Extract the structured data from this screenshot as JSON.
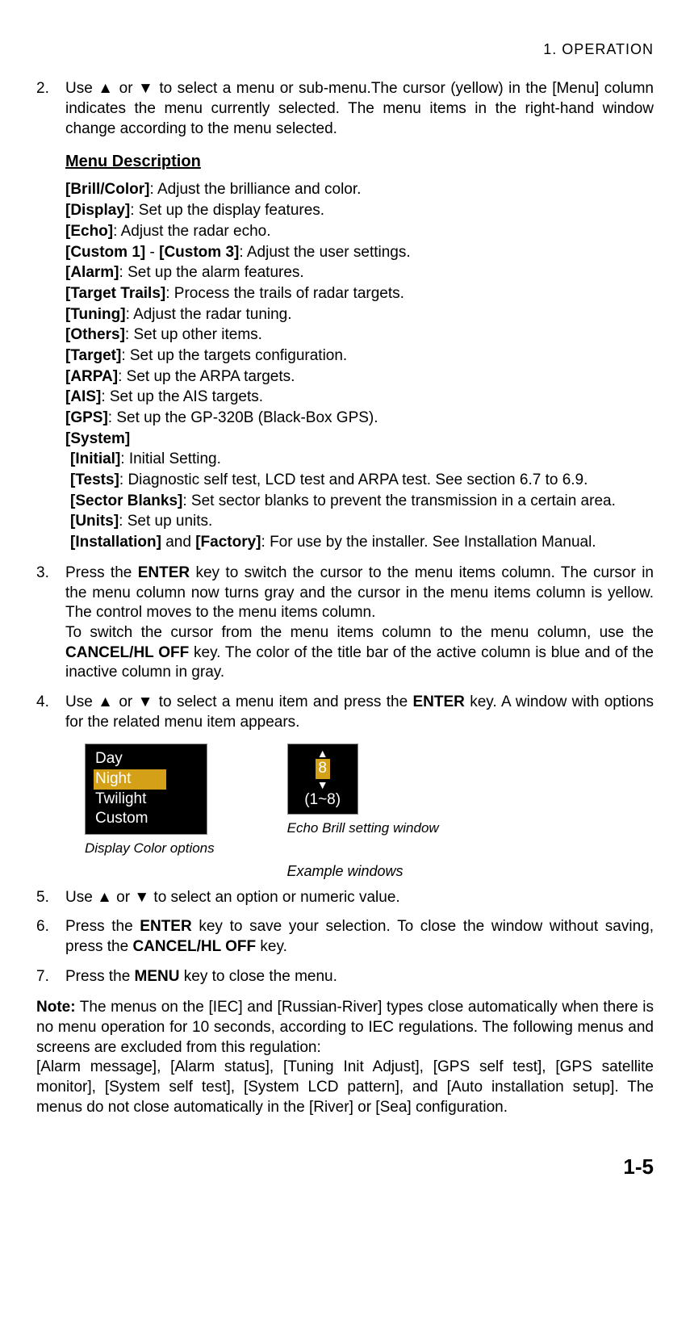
{
  "header": {
    "section": "1.  OPERATION"
  },
  "step2": {
    "num": "2.",
    "text_a": "Use ",
    "arr_up": "▲",
    "text_b": " or ",
    "arr_dn": "▼",
    "text_c": " to select a menu or sub-menu.The cursor (yellow) in the [Menu] column indicates the menu currently selected. The menu items in the right-hand window change according to the menu selected."
  },
  "menu_desc_title": "Menu Description",
  "menu_items": {
    "brill": {
      "label": "[Brill/Color]",
      "desc": ": Adjust the brilliance and color."
    },
    "display": {
      "label": "[Display]",
      "desc": ": Set up the display features."
    },
    "echo": {
      "label": "[Echo]",
      "desc": ": Adjust the radar echo."
    },
    "custom_a": {
      "label": "[Custom 1]",
      "sep": " - ",
      "label2": "[Custom 3]",
      "desc": ": Adjust the user settings."
    },
    "alarm": {
      "label": "[Alarm]",
      "desc": ": Set up the alarm features."
    },
    "trails": {
      "label": "[Target Trails]",
      "desc": ": Process the trails of radar targets."
    },
    "tuning": {
      "label": "[Tuning]",
      "desc": ": Adjust the radar tuning."
    },
    "others": {
      "label": "[Others]",
      "desc": ": Set up other items."
    },
    "target": {
      "label": "[Target]",
      "desc": ": Set up the targets configuration."
    },
    "arpa": {
      "label": "[ARPA]",
      "desc": ": Set up the ARPA targets."
    },
    "ais": {
      "label": "[AIS]",
      "desc": ": Set up the AIS targets."
    },
    "gps": {
      "label": "[GPS]",
      "desc": ": Set up the GP-320B (Black-Box GPS)."
    },
    "system": {
      "label": "[System]"
    },
    "initial": {
      "label": "[Initial]",
      "desc": ": Initial Setting."
    },
    "tests": {
      "label": "[Tests]",
      "desc": ": Diagnostic self test, LCD test and ARPA test. See section 6.7 to 6.9."
    },
    "sector": {
      "label": "[Sector Blanks]",
      "desc": ": Set sector blanks to prevent the transmission in a certain area."
    },
    "units": {
      "label": "[Units]",
      "desc": ": Set up units."
    },
    "install": {
      "label": "[Installation]",
      "and": " and ",
      "label2": "[Factory]",
      "desc": ": For use by the installer. See Installation Manual."
    }
  },
  "step3": {
    "num": "3.",
    "a": "Press the ",
    "enter": "ENTER",
    "b": " key to switch the cursor to the menu items column. The cursor in the menu column now turns gray and the cursor in the menu items column is yellow. The control moves to the menu items column.",
    "c": "To switch the cursor from the menu items column to the menu column, use the ",
    "cancel": "CANCEL/HL OFF",
    "d": " key. The color of the title bar of the active column is blue and of the inactive column in gray."
  },
  "step4": {
    "num": "4.",
    "a": "Use ",
    "up": "▲",
    "b": " or ",
    "dn": "▼",
    "c": " to select a menu item and press the ",
    "enter": "ENTER",
    "d": " key. A window with options for the related menu item appears."
  },
  "fig1": {
    "opts": {
      "day": "Day",
      "night": "Night",
      "twilight": "Twilight",
      "custom": "Custom"
    },
    "cap": "Display Color options"
  },
  "fig2": {
    "up": "▲",
    "val": "8",
    "dn": "▼",
    "range": "(1~8)",
    "cap": "Echo Brill setting window"
  },
  "center_cap": "Example windows",
  "step5": {
    "num": "5.",
    "a": "Use ",
    "up": "▲",
    "b": " or ",
    "dn": "▼",
    "c": " to select an option or numeric value."
  },
  "step6": {
    "num": "6.",
    "a": "Press the ",
    "enter": "ENTER",
    "b": " key to save your selection. To close the window without saving, press the ",
    "cancel": "CANCEL/HL OFF",
    "c": " key."
  },
  "step7": {
    "num": "7.",
    "a": "Press the ",
    "menu": "MENU",
    "b": " key to close the menu."
  },
  "note": {
    "label": "Note:",
    "a": " The menus on the [IEC] and [Russian-River] types close automatically when there is no menu operation for 10 seconds, according to IEC regulations. The following menus and screens are excluded from this regulation:",
    "b": "[Alarm message], [Alarm status], [Tuning Init Adjust], [GPS self test], [GPS satellite monitor], [System self test], [System LCD pattern], and [Auto installation setup]. The menus do not close automatically in the [River] or [Sea] configuration."
  },
  "page_num": "1-5"
}
